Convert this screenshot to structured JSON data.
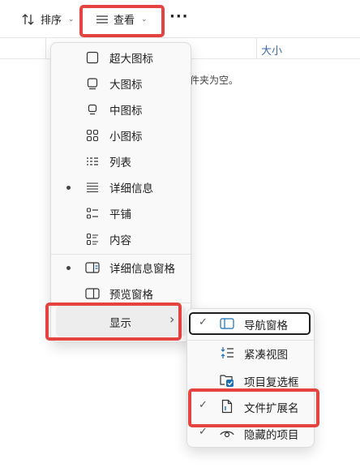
{
  "toolbar": {
    "sort_label": "排序",
    "view_label": "查看",
    "more_label": "···",
    "sort_icon": "sort-arrows-icon",
    "view_icon": "lines-icon"
  },
  "file_area": {
    "col_size": "大小",
    "empty_message": "文件夹为空。"
  },
  "view_menu": {
    "items": [
      {
        "label": "超大图标",
        "icon": "extra-large-icons-icon",
        "selected": false
      },
      {
        "label": "大图标",
        "icon": "large-icons-icon",
        "selected": false
      },
      {
        "label": "中图标",
        "icon": "medium-icons-icon",
        "selected": false
      },
      {
        "label": "小图标",
        "icon": "small-icons-icon",
        "selected": false
      },
      {
        "label": "列表",
        "icon": "list-icon",
        "selected": false
      },
      {
        "label": "详细信息",
        "icon": "details-icon",
        "selected": true
      },
      {
        "label": "平铺",
        "icon": "tiles-icon",
        "selected": false
      },
      {
        "label": "内容",
        "icon": "content-icon",
        "selected": false
      }
    ],
    "panes": [
      {
        "label": "详细信息窗格",
        "icon": "details-pane-icon",
        "selected": true
      },
      {
        "label": "预览窗格",
        "icon": "preview-pane-icon",
        "selected": false
      }
    ],
    "show_label": "显示",
    "show_arrow": "›"
  },
  "show_submenu": {
    "items": [
      {
        "label": "导航窗格",
        "icon": "navigation-pane-icon",
        "checked": true
      },
      {
        "label": "紧凑视图",
        "icon": "compact-view-icon",
        "checked": false
      },
      {
        "label": "项目复选框",
        "icon": "item-checkboxes-icon",
        "checked": false
      },
      {
        "label": "文件扩展名",
        "icon": "file-extension-icon",
        "checked": true
      },
      {
        "label": "隐藏的项目",
        "icon": "hidden-items-icon",
        "checked": true
      }
    ],
    "check_glyph": "✓"
  },
  "colors": {
    "highlight_red": "#e5433f",
    "accent_blue": "#3d6aa8",
    "pane_icon_blue": "#1a6fb5"
  }
}
